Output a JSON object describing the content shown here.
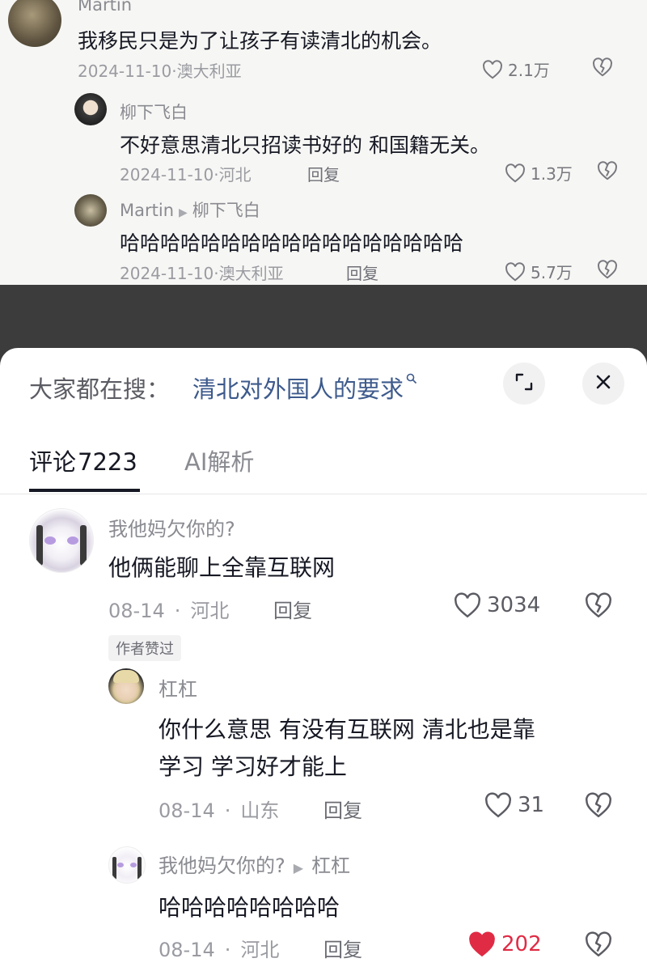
{
  "top_thread": {
    "comment": {
      "user": "Martin",
      "text": "我移民只是为了让孩子有读清北的机会。",
      "meta": "2024-11-10·澳大利亚",
      "likes": "2.1万"
    },
    "replies": [
      {
        "user": "柳下飞白",
        "text": "不好意思清北只招读书好的 和国籍无关。",
        "meta": "2024-11-10·河北",
        "reply_label": "回复",
        "likes": "1.3万"
      },
      {
        "user": "Martin",
        "reply_to": "柳下飞白",
        "text": "哈哈哈哈哈哈哈哈哈哈哈哈哈哈哈哈哈",
        "meta": "2024-11-10·澳大利亚",
        "reply_label": "回复",
        "likes": "5.7万"
      }
    ]
  },
  "sheet": {
    "search_label": "大家都在搜：",
    "search_query": "清北对外国人的要求",
    "tabs": [
      {
        "label": "评论",
        "count": "7223",
        "active": true
      },
      {
        "label": "AI解析",
        "active": false
      }
    ],
    "comment": {
      "user": "我他妈欠你的?",
      "text": "他俩能聊上全靠互联网",
      "date": "08-14",
      "location": "河北",
      "reply_label": "回复",
      "likes": "3034",
      "badge": "作者赞过"
    },
    "replies": [
      {
        "user": "杠杠",
        "text_line1": "你什么意思 有没有互联网 清北也是靠",
        "text_line2": "学习 学习好才能上",
        "date": "08-14",
        "location": "山东",
        "reply_label": "回复",
        "likes": "31"
      },
      {
        "user": "我他妈欠你的?",
        "reply_to": "杠杠",
        "text": "哈哈哈哈哈哈哈哈",
        "date": "08-14",
        "location": "河北",
        "reply_label": "回复",
        "likes": "202",
        "liked": true
      }
    ]
  },
  "colors": {
    "link_blue": "#3d5a8c",
    "like_red": "#e02b45",
    "text_primary": "#161823",
    "text_secondary": "#8a8b91"
  },
  "icons": [
    "heart-icon",
    "dislike-heart-icon",
    "search-icon",
    "expand-icon",
    "close-icon",
    "reply-arrow-icon"
  ]
}
